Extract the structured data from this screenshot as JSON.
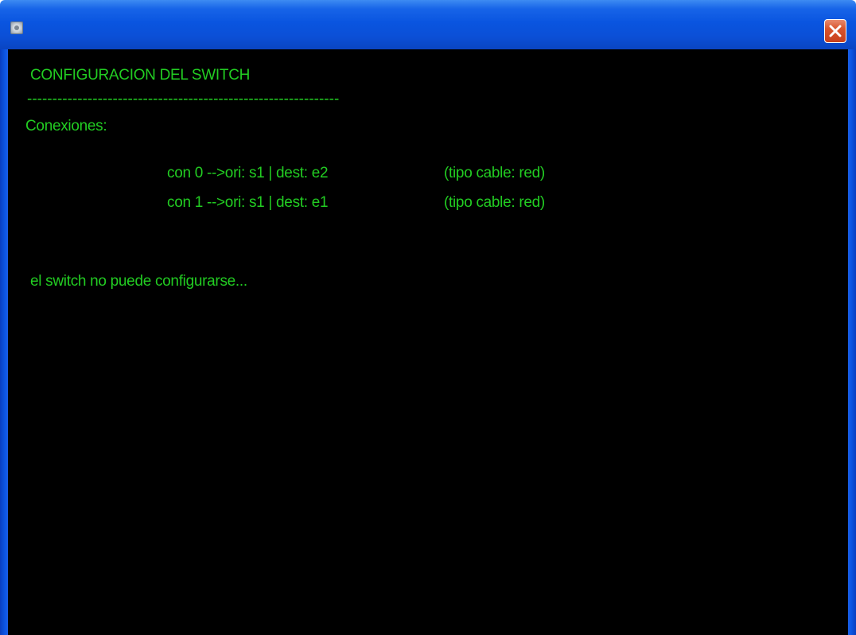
{
  "window": {
    "title": "",
    "close_label": "✕"
  },
  "console": {
    "heading": "CONFIGURACION DEL SWITCH",
    "separator": "--------------------------------------------------------------",
    "connections_label": "Conexiones:",
    "connections": [
      {
        "text": "con 0 -->ori: s1 | dest: e2",
        "cable": "(tipo cable: red)"
      },
      {
        "text": "con 1 -->ori: s1 | dest: e1",
        "cable": "(tipo cable: red)"
      }
    ],
    "status": "el switch no puede configurarse..."
  },
  "colors": {
    "background": "#000000",
    "text": "#22cc22",
    "titlebar": "#0a55e0",
    "close_button": "#d9542c"
  }
}
